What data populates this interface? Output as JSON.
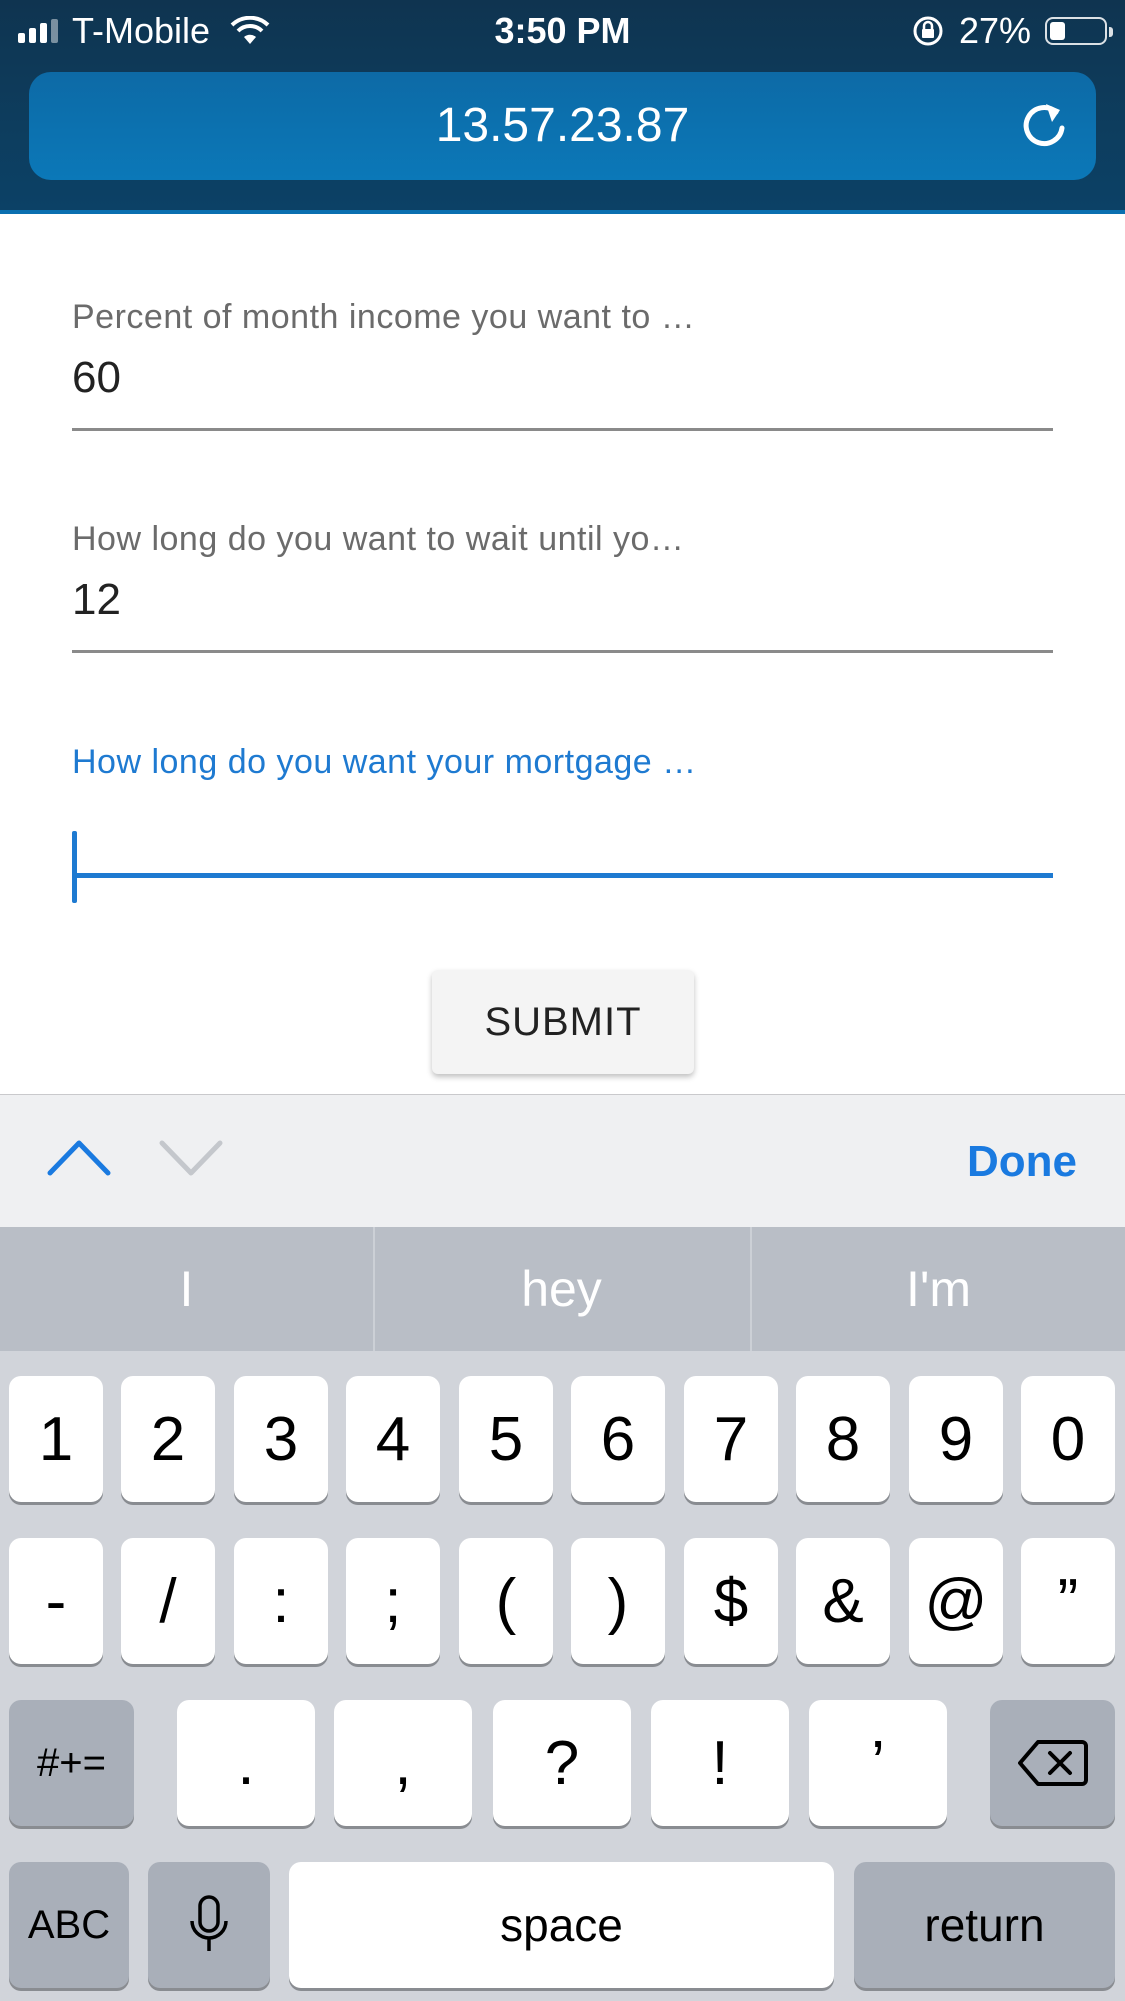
{
  "status_bar": {
    "carrier": "T-Mobile",
    "time": "3:50 PM",
    "battery_percent": "27%",
    "battery_level": 0.27
  },
  "browser": {
    "url": "13.57.23.87"
  },
  "form": {
    "fields": [
      {
        "label": "Percent of month income you want to …",
        "value": "60"
      },
      {
        "label": "How long do you want to wait until yo…",
        "value": "12"
      },
      {
        "label": "How long do you want your mortgage …",
        "value": ""
      }
    ],
    "submit_label": "SUBMIT"
  },
  "accessory": {
    "done_label": "Done"
  },
  "keyboard": {
    "suggestions": [
      "I",
      "hey",
      "I'm"
    ],
    "row1": [
      "1",
      "2",
      "3",
      "4",
      "5",
      "6",
      "7",
      "8",
      "9",
      "0"
    ],
    "row2": [
      "-",
      "/",
      ":",
      ";",
      "(",
      ")",
      "$",
      "&",
      "@",
      "”"
    ],
    "row3": [
      "#+=",
      ".",
      ",",
      "?",
      "!",
      "’"
    ],
    "row4": {
      "abc": "ABC",
      "space": "space",
      "return": "return"
    }
  },
  "colors": {
    "accent": "#1e7ad1",
    "chrome": "#0d3d5e"
  }
}
